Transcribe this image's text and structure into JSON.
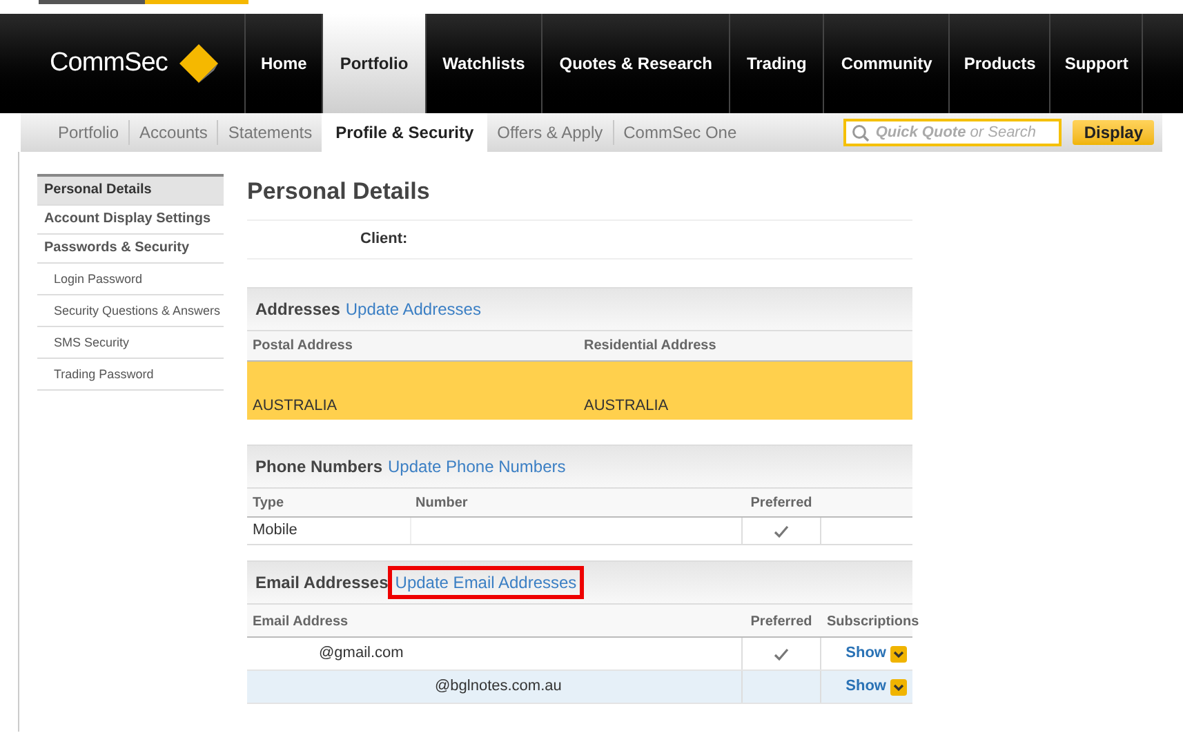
{
  "nav": {
    "logo": "CommSec",
    "items": [
      {
        "label": "Home",
        "selected": false
      },
      {
        "label": "Portfolio",
        "selected": true
      },
      {
        "label": "Watchlists",
        "selected": false
      },
      {
        "label": "Quotes & Research",
        "selected": false
      },
      {
        "label": "Trading",
        "selected": false
      },
      {
        "label": "Community",
        "selected": false
      },
      {
        "label": "Products",
        "selected": false
      },
      {
        "label": "Support",
        "selected": false
      }
    ]
  },
  "subnav": {
    "items": [
      {
        "label": "Portfolio",
        "selected": false
      },
      {
        "label": "Accounts",
        "selected": false
      },
      {
        "label": "Statements",
        "selected": false
      },
      {
        "label": "Profile & Security",
        "selected": true
      },
      {
        "label": "Offers & Apply",
        "selected": false
      },
      {
        "label": "CommSec One",
        "selected": false
      }
    ],
    "search": "**Quick Quote** or Search",
    "display_button": "Display"
  },
  "sidebar": {
    "items": [
      {
        "label": "Personal Details",
        "selected": true
      },
      {
        "label": "Account Display Settings",
        "selected": false
      },
      {
        "label": "Passwords & Security",
        "selected": false,
        "children": [
          {
            "label": "Login Password",
            "selected": false
          },
          {
            "label": "Security Questions & Answers",
            "selected": false
          },
          {
            "label": "SMS Security",
            "selected": false
          },
          {
            "label": "Trading Password",
            "selected": false
          }
        ]
      }
    ]
  },
  "page_title": "Personal Details",
  "client_label": "Client:",
  "addresses": {
    "title": "Addresses",
    "link": "Update Addresses",
    "columns": [
      "Postal Address",
      "Residential Address"
    ],
    "row": {
      "highlighted": true,
      "cells": [
        "AUSTRALIA",
        "AUSTRALIA"
      ]
    }
  },
  "phones": {
    "title": "Phone Numbers",
    "link": "Update Phone Numbers",
    "columns": [
      "Type",
      "Number",
      "Preferred"
    ],
    "rows": [
      {
        "type": "Mobile",
        "preferred": true
      }
    ]
  },
  "emails": {
    "title": "Email Addresses",
    "link": "Update Email Addresses",
    "link_outlined": true,
    "columns": [
      "Email Address",
      "Preferred",
      "Subscriptions"
    ],
    "rows": [
      {
        "email": "@gmail.com",
        "preferred": true,
        "action": "Show",
        "selected": false,
        "indent": false
      },
      {
        "email": "@bglnotes.com.au",
        "preferred": false,
        "action": "Show",
        "selected": true,
        "indent": true
      }
    ]
  }
}
